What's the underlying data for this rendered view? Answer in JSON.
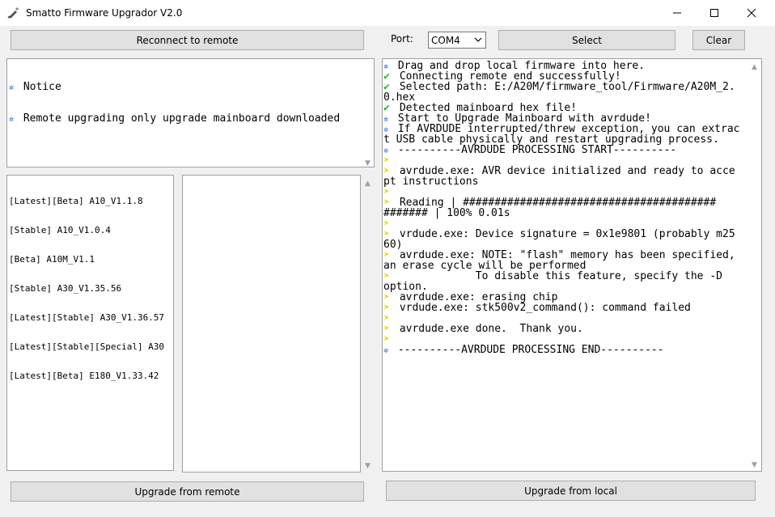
{
  "window": {
    "title": "Smatto Firmware Upgrador V2.0"
  },
  "toolbar": {
    "reconnect_label": "Reconnect to remote",
    "port_label": "Port:",
    "port_value": "COM4",
    "select_label": "Select",
    "clear_label": "Clear"
  },
  "notice_panel": {
    "lines": [
      "Notice",
      "Remote upgrading only upgrade mainboard downloaded"
    ]
  },
  "firmware_list": {
    "items": [
      "[Latest][Beta] A10_V1.1.8",
      "[Stable] A10_V1.0.4",
      "[Beta] A10M_V1.1",
      "[Stable] A30_V1.35.56",
      "[Latest][Stable] A30_V1.36.57",
      "[Latest][Stable][Special] A30",
      "[Latest][Beta] E180_V1.33.42"
    ]
  },
  "log": {
    "lines": [
      {
        "icon": "info",
        "text": "Drag and drop local firmware into here."
      },
      {
        "icon": "check",
        "text": "Connecting remote end successfully!"
      },
      {
        "icon": "check",
        "text": "Selected path: E:/A20M/firmware_tool/Firmware/A20M_2."
      },
      {
        "icon": "",
        "text": "0.hex"
      },
      {
        "icon": "check",
        "text": "Detected mainboard hex file!"
      },
      {
        "icon": "info",
        "text": "Start to Upgrade Mainboard with avrdude!"
      },
      {
        "icon": "info",
        "text": "If AVRDUDE interrupted/threw exception, you can extrac"
      },
      {
        "icon": "",
        "text": "t USB cable physically and restart upgrading process."
      },
      {
        "icon": "info",
        "text": "----------AVRDUDE PROCESSING START----------"
      },
      {
        "icon": "arrow",
        "text": ""
      },
      {
        "icon": "arrow",
        "text": "avrdude.exe: AVR device initialized and ready to acce"
      },
      {
        "icon": "",
        "text": "pt instructions"
      },
      {
        "icon": "arrow",
        "text": ""
      },
      {
        "icon": "arrow",
        "text": "Reading | ########################################"
      },
      {
        "icon": "",
        "text": "####### | 100% 0.01s"
      },
      {
        "icon": "arrow",
        "text": ""
      },
      {
        "icon": "arrow",
        "text": "vrdude.exe: Device signature = 0x1e9801 (probably m25"
      },
      {
        "icon": "",
        "text": "60)"
      },
      {
        "icon": "arrow",
        "text": "avrdude.exe: NOTE: \"flash\" memory has been specified,"
      },
      {
        "icon": "",
        "text": "an erase cycle will be performed"
      },
      {
        "icon": "arrow",
        "text": "            To disable this feature, specify the -D"
      },
      {
        "icon": "",
        "text": "option."
      },
      {
        "icon": "arrow",
        "text": "avrdude.exe: erasing chip"
      },
      {
        "icon": "arrow",
        "text": "vrdude.exe: stk500v2_command(): command failed"
      },
      {
        "icon": "arrow",
        "text": ""
      },
      {
        "icon": "arrow",
        "text": "avrdude.exe done.  Thank you."
      },
      {
        "icon": "arrow",
        "text": ""
      },
      {
        "icon": "info",
        "text": "----------AVRDUDE PROCESSING END----------"
      }
    ]
  },
  "footer": {
    "upgrade_remote_label": "Upgrade from remote",
    "upgrade_local_label": "Upgrade from local"
  },
  "icons": {
    "info": "info-bullet-icon",
    "check": "check-icon",
    "arrow": "arrow-right-icon"
  },
  "colors": {
    "info": "#1b5fd9",
    "check": "#2eb52e",
    "arrow": "#e8e000"
  }
}
